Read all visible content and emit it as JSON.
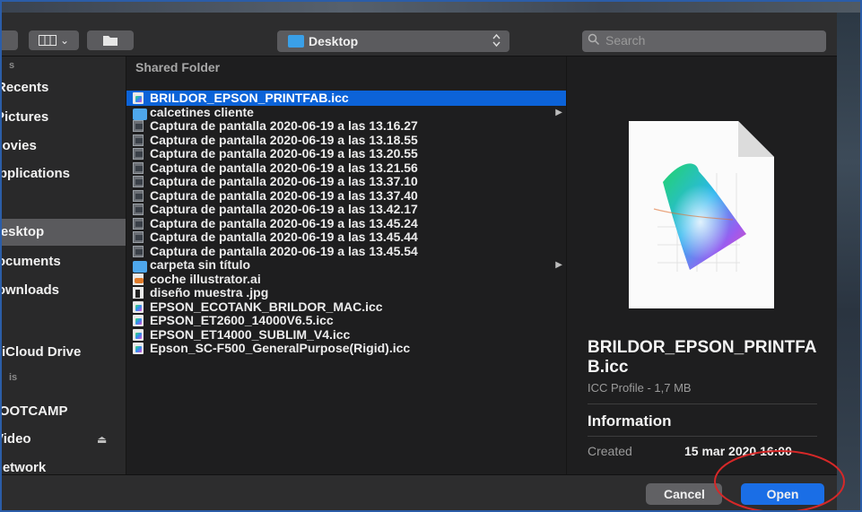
{
  "toolbar": {
    "view_chevron": "⌄",
    "location": "Desktop",
    "search_placeholder": "Search"
  },
  "sidebar": {
    "items": [
      {
        "label": "Recents",
        "selected": false
      },
      {
        "label": "Pictures",
        "selected": false
      },
      {
        "label": "Movies",
        "selected": false
      },
      {
        "label": "Applications",
        "selected": false
      },
      {
        "label": "Desktop",
        "selected": true
      },
      {
        "label": "Documents",
        "selected": false
      },
      {
        "label": "Downloads",
        "selected": false
      },
      {
        "label": "iCloud Drive",
        "selected": false
      },
      {
        "label": "BOOTCAMP",
        "selected": false
      },
      {
        "label": "Video",
        "selected": false
      },
      {
        "label": "Network",
        "selected": false
      }
    ]
  },
  "file_list": {
    "header": "Shared Folder",
    "rows": [
      {
        "name": "BRILDOR_EPSON_PRINTFAB.icc",
        "icon": "icc",
        "selected": true,
        "folder": false
      },
      {
        "name": "calcetines cliente",
        "icon": "folder",
        "selected": false,
        "folder": true
      },
      {
        "name": "Captura de pantalla 2020-06-19 a las 13.16.27",
        "icon": "shot",
        "selected": false,
        "folder": false
      },
      {
        "name": "Captura de pantalla 2020-06-19 a las 13.18.55",
        "icon": "shot",
        "selected": false,
        "folder": false
      },
      {
        "name": "Captura de pantalla 2020-06-19 a las 13.20.55",
        "icon": "shot",
        "selected": false,
        "folder": false
      },
      {
        "name": "Captura de pantalla 2020-06-19 a las 13.21.56",
        "icon": "shot",
        "selected": false,
        "folder": false
      },
      {
        "name": "Captura de pantalla 2020-06-19 a las 13.37.10",
        "icon": "shot",
        "selected": false,
        "folder": false
      },
      {
        "name": "Captura de pantalla 2020-06-19 a las 13.37.40",
        "icon": "shot",
        "selected": false,
        "folder": false
      },
      {
        "name": "Captura de pantalla 2020-06-19 a las 13.42.17",
        "icon": "shot",
        "selected": false,
        "folder": false
      },
      {
        "name": "Captura de pantalla 2020-06-19 a las 13.45.24",
        "icon": "shot",
        "selected": false,
        "folder": false
      },
      {
        "name": "Captura de pantalla 2020-06-19 a las 13.45.44",
        "icon": "shot",
        "selected": false,
        "folder": false
      },
      {
        "name": "Captura de pantalla 2020-06-19 a las 13.45.54",
        "icon": "shot",
        "selected": false,
        "folder": false
      },
      {
        "name": "carpeta sin título",
        "icon": "folder",
        "selected": false,
        "folder": true
      },
      {
        "name": "coche illustrator.ai",
        "icon": "ai",
        "selected": false,
        "folder": false
      },
      {
        "name": "diseño muestra .jpg",
        "icon": "jpg",
        "selected": false,
        "folder": false
      },
      {
        "name": "EPSON_ECOTANK_BRILDOR_MAC.icc",
        "icon": "icc",
        "selected": false,
        "folder": false
      },
      {
        "name": "EPSON_ET2600_14000V6.5.icc",
        "icon": "icc",
        "selected": false,
        "folder": false
      },
      {
        "name": "EPSON_ET14000_SUBLIM_V4.icc",
        "icon": "icc",
        "selected": false,
        "folder": false
      },
      {
        "name": "Epson_SC-F500_GeneralPurpose(Rigid).icc",
        "icon": "icc",
        "selected": false,
        "folder": false
      }
    ]
  },
  "preview": {
    "name": "BRILDOR_EPSON_PRINTFAB.icc",
    "kind": "ICC Profile - 1,7 MB",
    "info_title": "Information",
    "created_label": "Created",
    "created_value": "15 mar 2020 16:00"
  },
  "footer": {
    "cancel_label": "Cancel",
    "open_label": "Open"
  },
  "colors": {
    "selection": "#0c63d8",
    "open_button": "#1a6ee6",
    "annotation": "#d62828"
  }
}
